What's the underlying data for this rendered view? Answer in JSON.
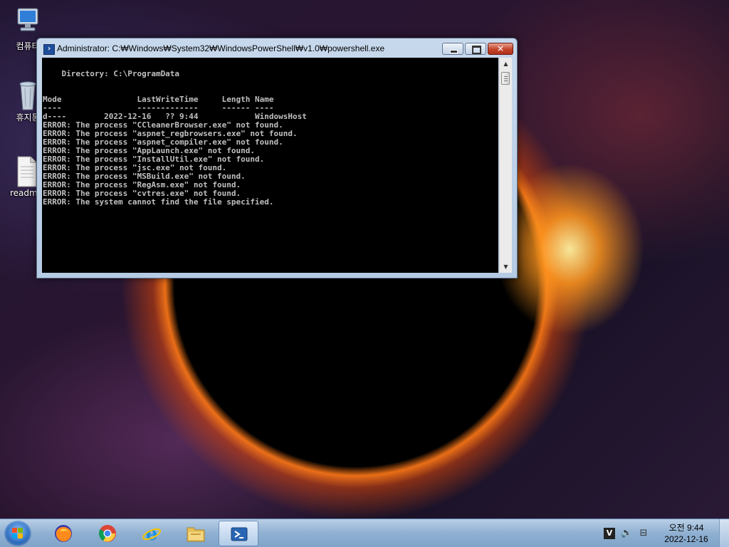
{
  "desktop": {
    "icons": [
      {
        "label": "컴퓨터",
        "icon": "computer-icon"
      },
      {
        "label": "휴지통",
        "icon": "recycle-bin-icon"
      },
      {
        "label": "readme",
        "icon": "text-document-icon"
      }
    ]
  },
  "window": {
    "title": "Administrator: C:₩Windows₩System32₩WindowsPowerShell₩v1.0₩powershell.exe",
    "icon": "powershell-icon",
    "controls": {
      "minimize": "minimize",
      "maximize": "maximize",
      "close": "close"
    },
    "console_lines": [
      "    Directory: C:\\ProgramData",
      "",
      "",
      "Mode                LastWriteTime     Length Name",
      "----                -------------     ------ ----",
      "d----        2022-12-16   ?? 9:44            WindowsHost",
      "ERROR: The process \"CCleanerBrowser.exe\" not found.",
      "ERROR: The process \"aspnet_regbrowsers.exe\" not found.",
      "ERROR: The process \"aspnet_compiler.exe\" not found.",
      "ERROR: The process \"AppLaunch.exe\" not found.",
      "ERROR: The process \"InstallUtil.exe\" not found.",
      "ERROR: The process \"jsc.exe\" not found.",
      "ERROR: The process \"MSBuild.exe\" not found.",
      "ERROR: The process \"RegAsm.exe\" not found.",
      "ERROR: The process \"cvtres.exe\" not found.",
      "ERROR: The system cannot find the file specified."
    ]
  },
  "taskbar": {
    "start": "start-orb",
    "apps": [
      {
        "name": "firefox",
        "icon": "firefox-icon"
      },
      {
        "name": "chrome",
        "icon": "chrome-icon"
      },
      {
        "name": "internet-explorer",
        "icon": "ie-icon"
      },
      {
        "name": "file-explorer",
        "icon": "folder-icon"
      },
      {
        "name": "powershell",
        "icon": "powershell-icon",
        "active": true
      }
    ],
    "tray": {
      "icons": [
        "ime-icon",
        "volume-icon",
        "network-icon"
      ],
      "time": "오전 9:44",
      "date": "2022-12-16"
    }
  },
  "colors": {
    "console_bg": "#000000",
    "console_fg": "#c0c0c0",
    "titlebar": "#c7d8ec",
    "close_button": "#c3442a"
  }
}
